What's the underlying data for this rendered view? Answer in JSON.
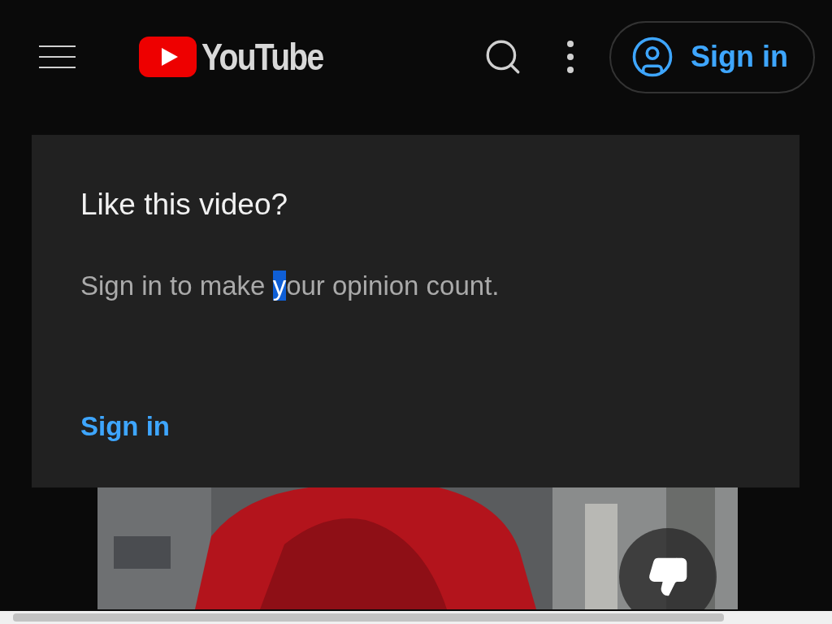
{
  "header": {
    "logo_text": "YouTube",
    "sign_in_button": "Sign in"
  },
  "dialog": {
    "title": "Like this video?",
    "message": {
      "before": "Sign in to make ",
      "selected_text": "y",
      "after": "our opinion count."
    },
    "link": "Sign in"
  }
}
